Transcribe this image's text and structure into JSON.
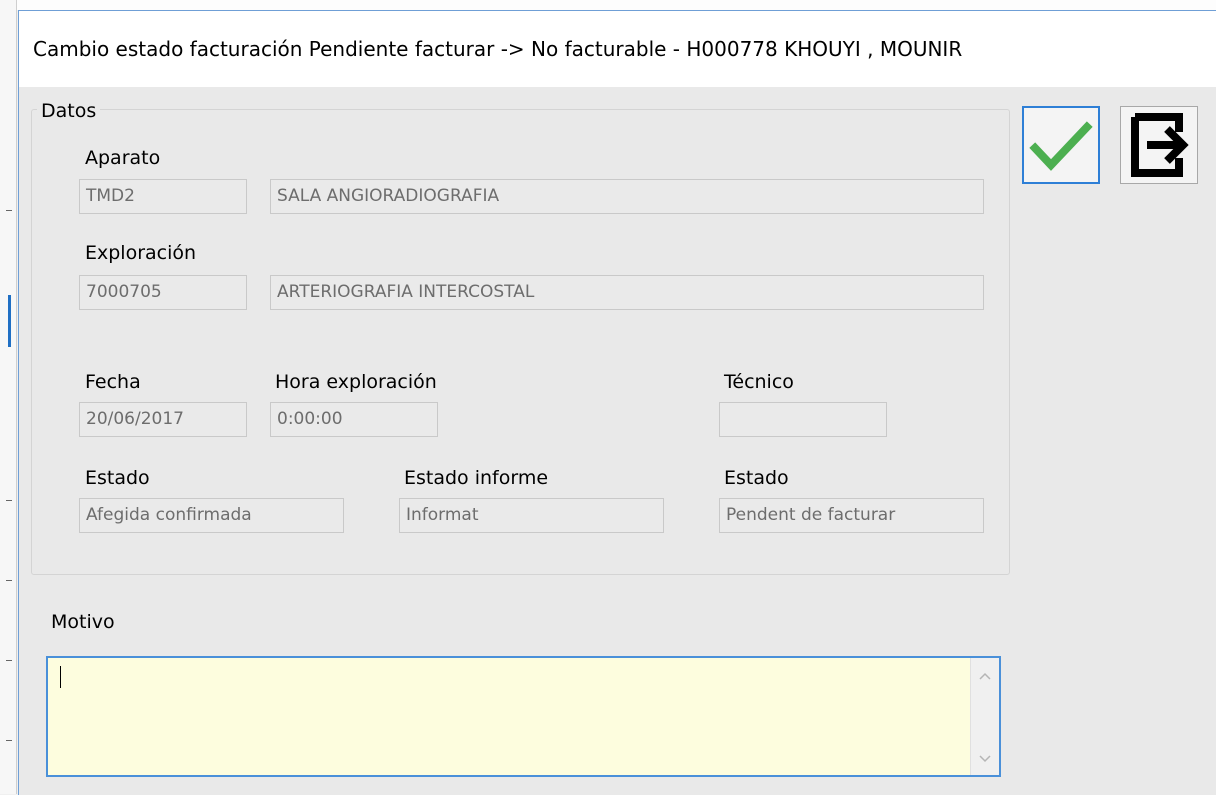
{
  "dialog": {
    "title": "Cambio estado facturación Pendiente facturar -> No facturable - H000778 KHOUYI  , MOUNIR"
  },
  "datos": {
    "caption": "Datos",
    "aparato": {
      "label": "Aparato",
      "code": "TMD2",
      "description": "SALA ANGIORADIOGRAFIA"
    },
    "exploracion": {
      "label": "Exploración",
      "code": "7000705",
      "description": "ARTERIOGRAFIA INTERCOSTAL"
    },
    "fecha": {
      "label": "Fecha",
      "value": "20/06/2017"
    },
    "hora_exploracion": {
      "label": "Hora exploración",
      "value": "0:00:00"
    },
    "tecnico": {
      "label": "Técnico",
      "value": ""
    },
    "estado": {
      "label": "Estado",
      "value": "Afegida confirmada"
    },
    "estado_informe": {
      "label": "Estado informe",
      "value": "Informat"
    },
    "estado_facturacion": {
      "label": "Estado",
      "value": "Pendent de facturar"
    }
  },
  "motivo": {
    "label": "Motivo",
    "value": ""
  },
  "buttons": {
    "accept_icon": "checkmark-icon",
    "exit_icon": "exit-arrow-icon",
    "accept_color": "#4caf50"
  }
}
